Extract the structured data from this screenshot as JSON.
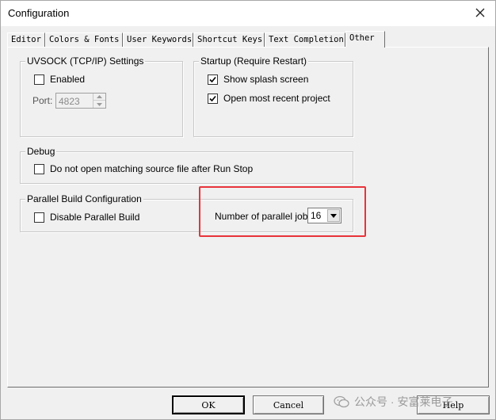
{
  "window": {
    "title": "Configuration"
  },
  "tabs": [
    {
      "label": "Editor"
    },
    {
      "label": "Colors & Fonts"
    },
    {
      "label": "User Keywords"
    },
    {
      "label": "Shortcut Keys"
    },
    {
      "label": "Text Completion"
    },
    {
      "label": "Other",
      "active": true
    }
  ],
  "uvsock": {
    "legend": "UVSOCK (TCP/IP) Settings",
    "enabled_label": "Enabled",
    "enabled_checked": false,
    "port_label": "Port:",
    "port_value": "4823"
  },
  "startup": {
    "legend": "Startup (Require Restart)",
    "splash_label": "Show splash screen",
    "splash_checked": true,
    "recent_label": "Open most recent project",
    "recent_checked": true
  },
  "debug": {
    "legend": "Debug",
    "no_open_label": "Do not open matching source file after Run Stop",
    "no_open_checked": false
  },
  "parallel": {
    "legend": "Parallel Build Configuration",
    "disable_label": "Disable Parallel Build",
    "disable_checked": false,
    "jobs_label": "Number of parallel jobs:",
    "jobs_value": "16"
  },
  "buttons": {
    "ok": "OK",
    "cancel": "Cancel",
    "help": "Help"
  },
  "watermark": {
    "text": "公众号 · 安富莱电子"
  },
  "colors": {
    "highlight": "#e8343a"
  }
}
